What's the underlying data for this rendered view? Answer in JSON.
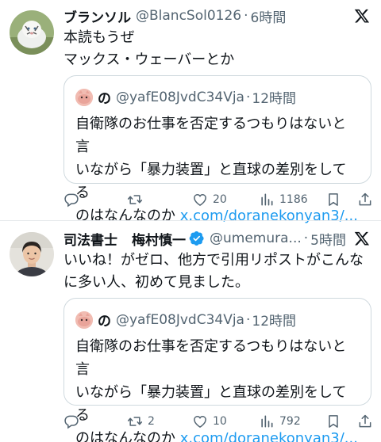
{
  "posts": [
    {
      "author_name": "ブランソル",
      "author_name_2": "",
      "handle": "@BlancSol0126",
      "dot": "·",
      "time": "6時間",
      "text_lines": [
        "本読もうぜ",
        "マックス・ウェーバーとか"
      ],
      "quote": {
        "name": "の",
        "handle": "@yafE08JvdC34Vja",
        "dot": "·",
        "time": "12時間",
        "line1": "自衛隊のお仕事を否定するつもりはないと言",
        "line2": "いながら「暴力装置」と直球の差別をしてる",
        "line3_text": "のはなんなのか ",
        "line3_link": "x.com/doranekonyan3/..."
      },
      "actions": {
        "reply": "",
        "retweet": "",
        "like": "20",
        "views": "1186"
      }
    },
    {
      "author_name": "司法書士",
      "author_name_2": "梅村慎一",
      "handle": "@umemura...",
      "dot": "·",
      "time": "5時間",
      "text_lines": [
        "いいね！がゼロ、他方で引用リポストがこんな",
        "に多い人、初めて見ました。"
      ],
      "quote": {
        "name": "の",
        "handle": "@yafE08JvdC34Vja",
        "dot": "·",
        "time": "12時間",
        "line1": "自衛隊のお仕事を否定するつもりはないと言",
        "line2": "いながら「暴力装置」と直球の差別をしてる",
        "line3_text": "のはなんなのか ",
        "line3_link": "x.com/doranekonyan3/..."
      },
      "actions": {
        "reply": "",
        "retweet": "2",
        "like": "10",
        "views": "792"
      }
    }
  ],
  "colors": {
    "text": "#0f1419",
    "secondary": "#536471",
    "link": "#1d9bf0",
    "verified": "#1d9bf0",
    "border": "#cfd9de"
  },
  "icons": [
    "x-logo-icon",
    "reply-icon",
    "retweet-icon",
    "like-icon",
    "views-icon",
    "bookmark-icon",
    "share-icon",
    "verified-badge-icon"
  ]
}
